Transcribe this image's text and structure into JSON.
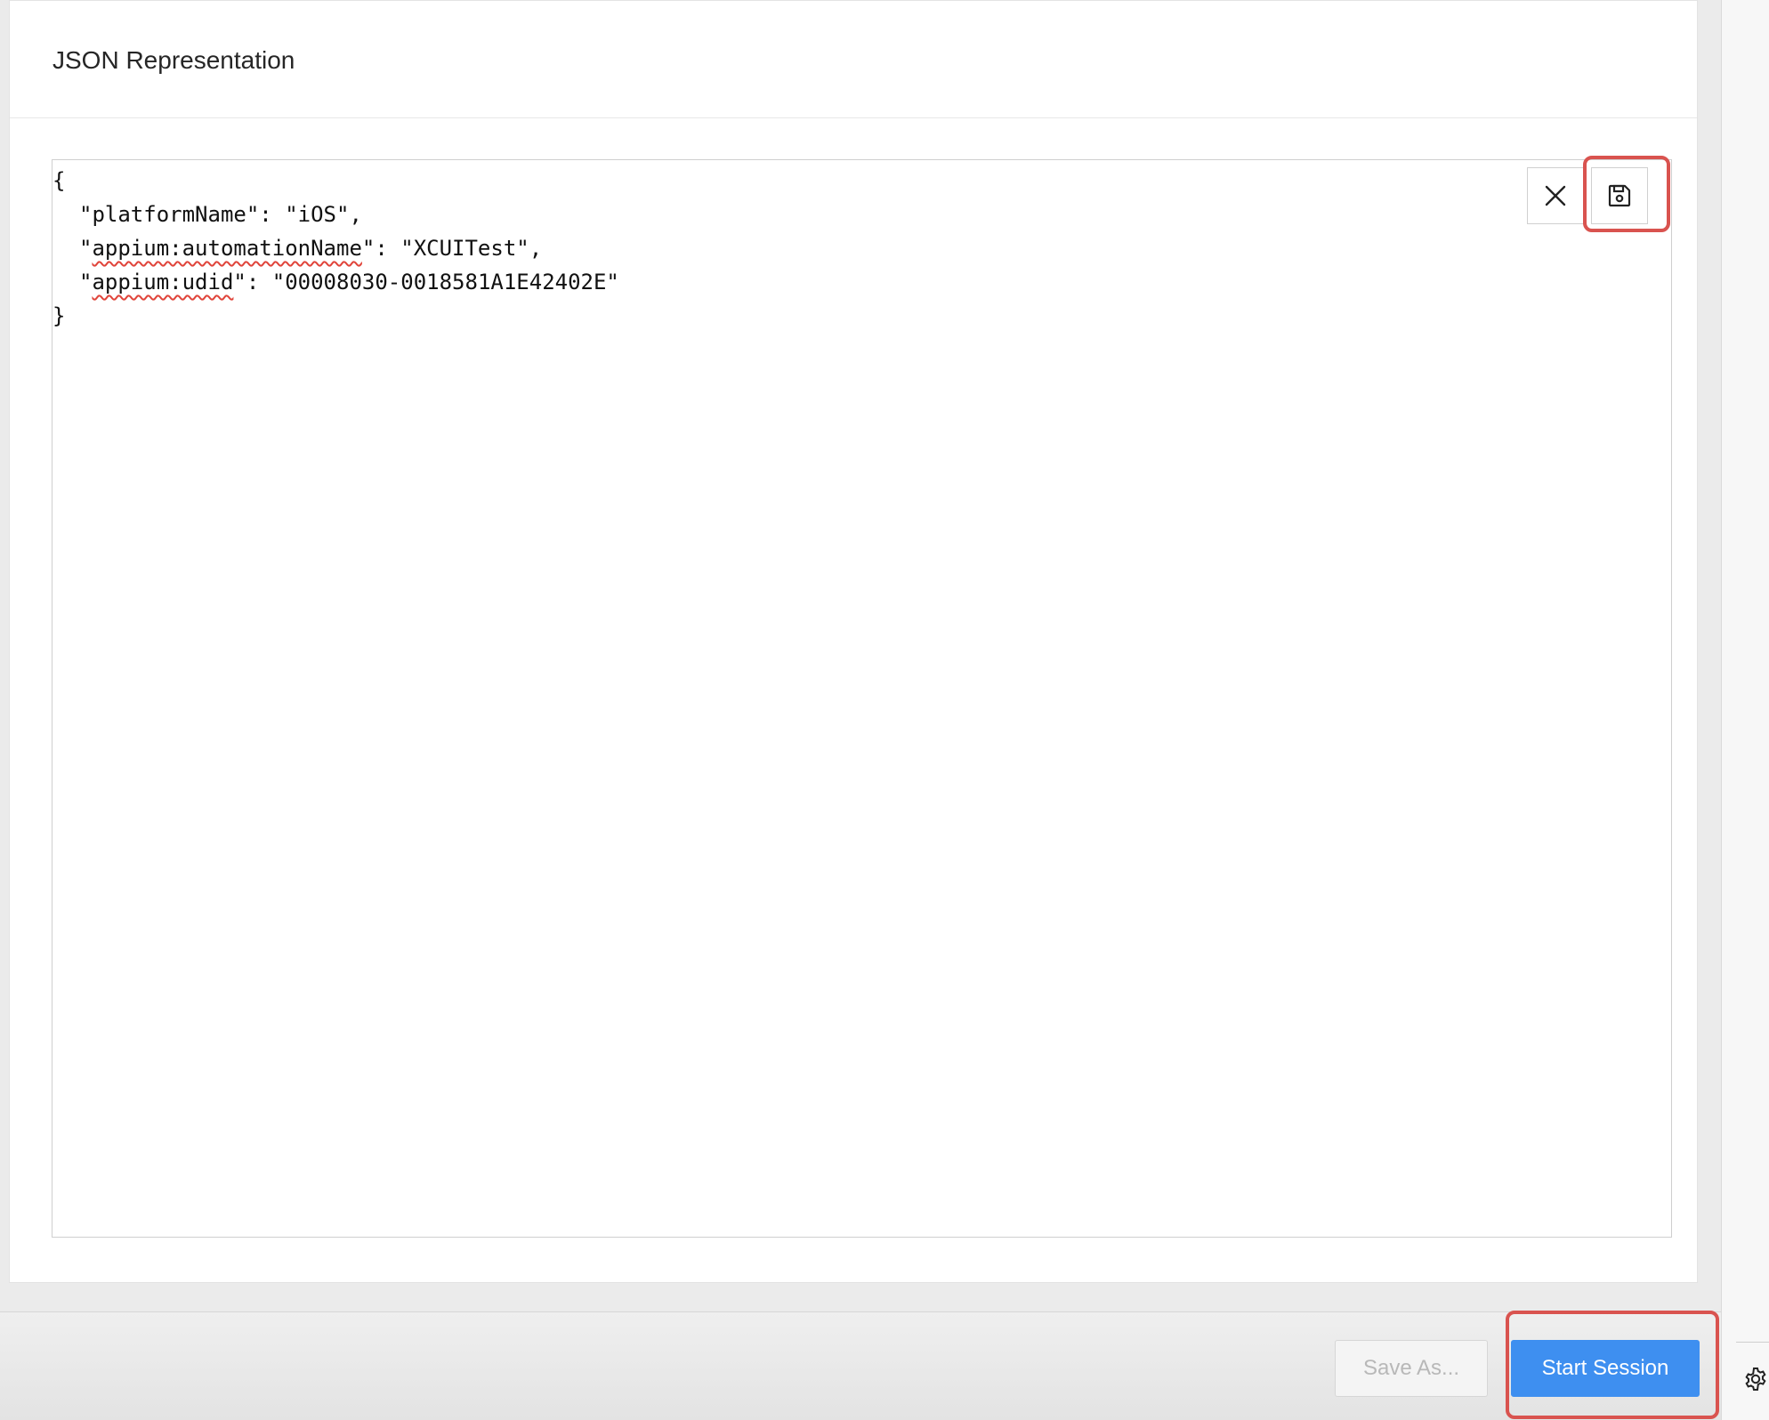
{
  "panel": {
    "title": "JSON Representation"
  },
  "editor": {
    "open_brace": "{",
    "close_brace": "}",
    "lines": [
      {
        "q1": "\"",
        "key": "platformName",
        "rest": "\": \"iOS\","
      },
      {
        "q1": "\"",
        "key": "appium:automationName",
        "rest": "\": \"XCUITest\","
      },
      {
        "q1": "\"",
        "key": "appium:udid",
        "rest": "\": \"00008030-0018581A1E42402E\""
      }
    ],
    "clear_icon": "close-icon",
    "save_icon": "floppy-disk-icon"
  },
  "footer": {
    "save_as_label": "Save As...",
    "start_session_label": "Start Session"
  },
  "sidebar": {
    "settings_icon": "gear-icon"
  },
  "colors": {
    "primary": "#3e8ff0",
    "highlight": "#d9534f",
    "spell_error": "#e0443a"
  }
}
